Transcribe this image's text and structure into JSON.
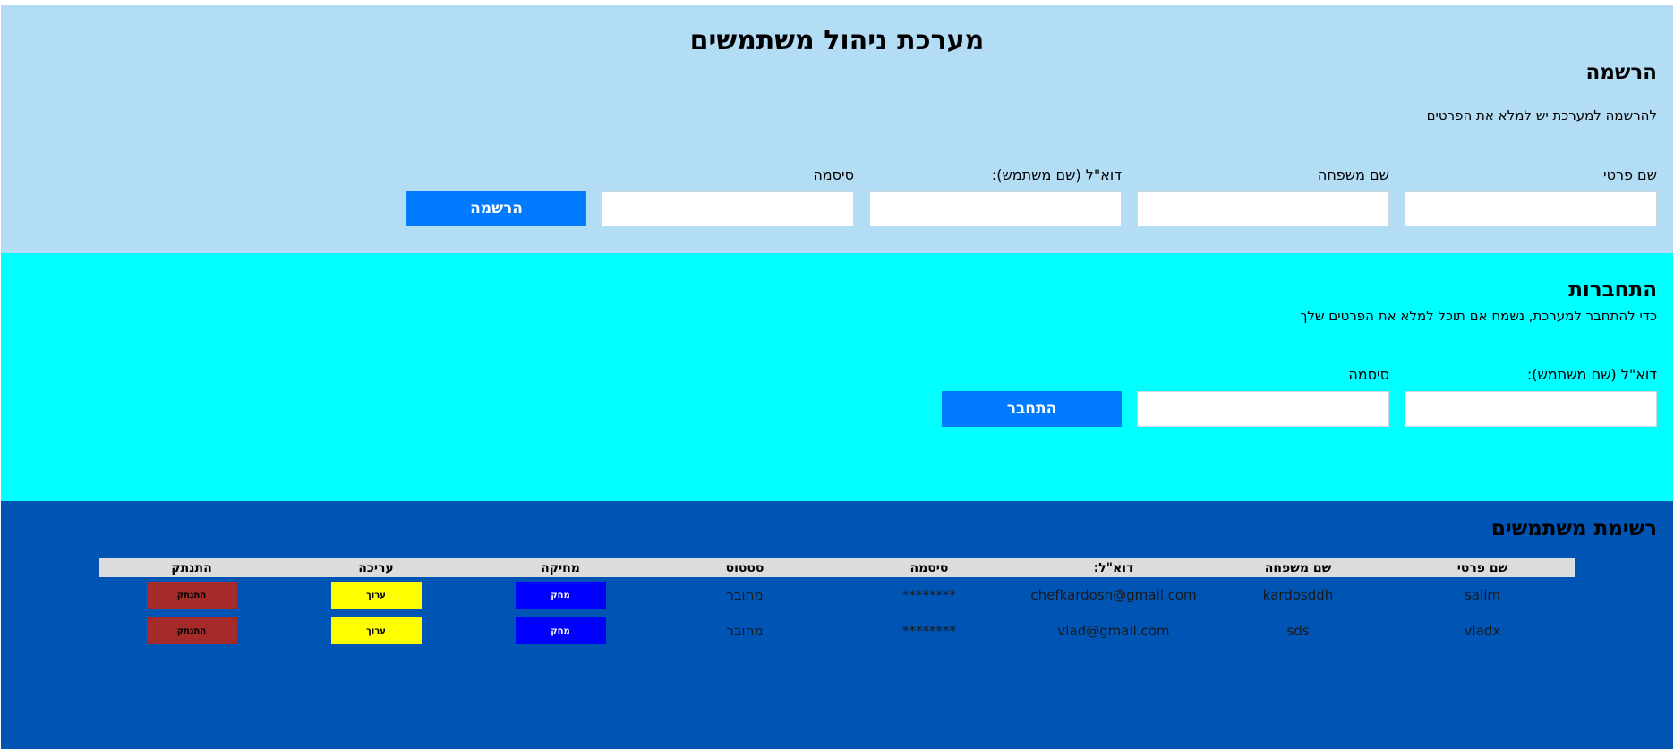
{
  "page": {
    "title": "מערכת ניהול משתמשים"
  },
  "register": {
    "title": "הרשמה",
    "subtitle": "להרשמה למערכת יש למלא את הפרטים",
    "labels": {
      "first_name": "שם פרטי",
      "last_name": "שם משפחה",
      "email": "דוא\"ל (שם משתמש):",
      "password": "סיסמה"
    },
    "button": "הרשמה"
  },
  "login": {
    "title": "התחברות",
    "subtitle": "כדי להתחבר למערכת, נשמח אם תוכל למלא את הפרטים שלך",
    "labels": {
      "email": "דוא\"ל (שם משתמש):",
      "password": "סיסמה"
    },
    "button": "התחבר"
  },
  "users": {
    "title": "רשימת משתמשים",
    "columns": [
      "שם פרטי",
      "שם משפחה",
      "דוא\"ל:",
      "סיסמה",
      "סטטוס",
      "מחיקה",
      "עריכה",
      "התנתק"
    ],
    "rows": [
      {
        "first": "salim",
        "last": "kardosddh",
        "email": "chefkardosh@gmail.com",
        "password": "********",
        "status": "מחובר",
        "delete": "מחק",
        "edit": "ערוך",
        "logout": "התנתק"
      },
      {
        "first": "vladx",
        "last": "sds",
        "email": "vlad@gmail.com",
        "password": "********",
        "status": "מחובר",
        "delete": "מחק",
        "edit": "ערוך",
        "logout": "התנתק"
      }
    ]
  },
  "colors": {
    "register_bg": "#b3dcf5",
    "login_bg": "#00ffff",
    "users_bg": "#0054b4",
    "primary_button": "#007bff",
    "delete_button": "#0000ff",
    "edit_button": "#ffff00",
    "logout_button": "#a52a2a"
  }
}
